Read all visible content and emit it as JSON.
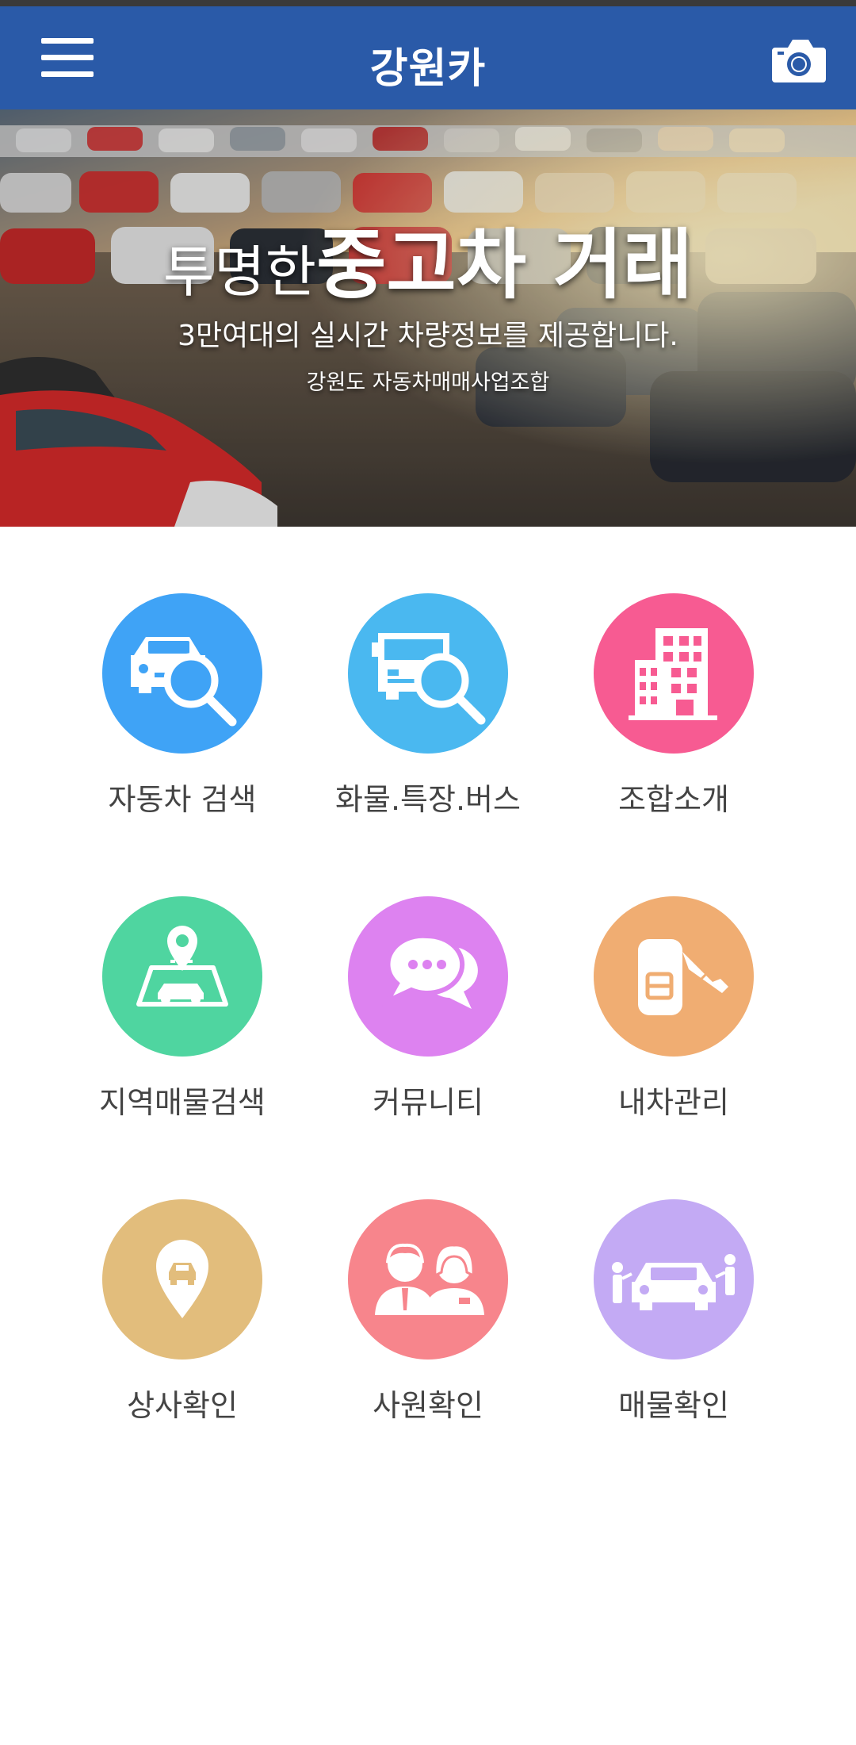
{
  "app_bar": {
    "title": "강원카",
    "menu_icon": "hamburger-menu-icon",
    "camera_icon": "camera-icon",
    "color": "#2a5aa8"
  },
  "banner": {
    "headline_light": "투명한",
    "headline_bold": "중고차 거래",
    "subtitle": "3만여대의 실시간 차량정보를 제공합니다.",
    "organization": "강원도 자동차매매사업조합"
  },
  "menu": {
    "items": [
      {
        "label": "자동차 검색",
        "icon": "car-search-icon",
        "color": "#3fa3f6"
      },
      {
        "label": "화물.특장.버스",
        "icon": "truck-search-icon",
        "color": "#4ab8f0"
      },
      {
        "label": "조합소개",
        "icon": "building-icon",
        "color": "#f75b92"
      },
      {
        "label": "지역매물검색",
        "icon": "map-pin-icon",
        "color": "#4fd5a0"
      },
      {
        "label": "커뮤니티",
        "icon": "chat-bubbles-icon",
        "color": "#dd82f0"
      },
      {
        "label": "내차관리",
        "icon": "car-key-icon",
        "color": "#f0ad72"
      },
      {
        "label": "상사확인",
        "icon": "location-car-icon",
        "color": "#e2bd7c"
      },
      {
        "label": "사원확인",
        "icon": "staff-icon",
        "color": "#f7858c"
      },
      {
        "label": "매물확인",
        "icon": "car-dealers-icon",
        "color": "#c3aaf4"
      }
    ]
  }
}
